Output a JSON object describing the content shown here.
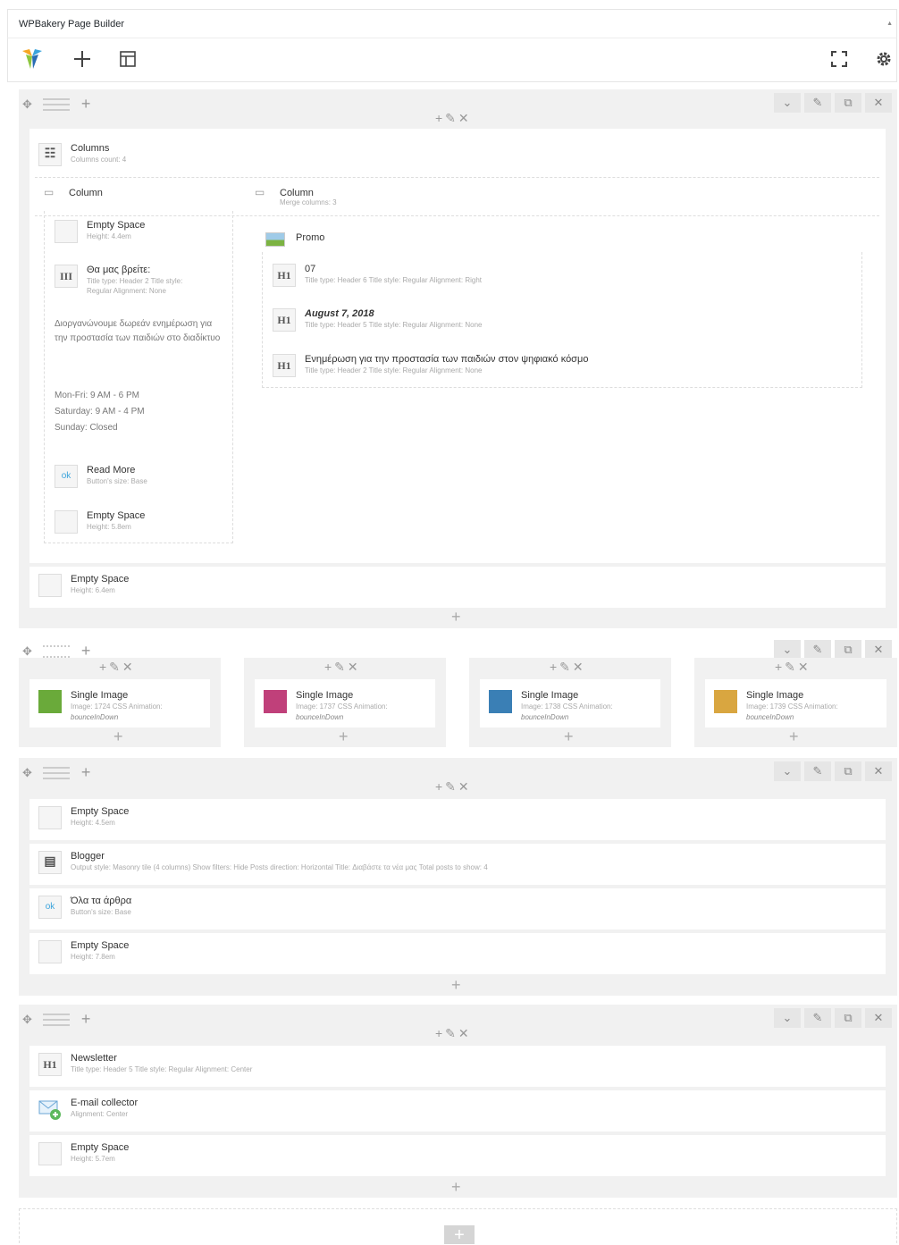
{
  "panel": {
    "title": "WPBakery Page Builder"
  },
  "row1": {
    "columns_el": {
      "title": "Columns",
      "meta": "Columns count: 4"
    },
    "col_left": {
      "title": "Column"
    },
    "col_right": {
      "title": "Column",
      "meta": "Merge columns: 3"
    },
    "left_items": [
      {
        "title": "Empty Space",
        "meta": "Height: 4.4em"
      },
      {
        "title": "Θα μας βρείτε:",
        "meta1": "Title type: Header 2  Title style:",
        "meta2": "Regular  Alignment: None"
      },
      {
        "title": "Read More",
        "meta": "Button's size: Base"
      },
      {
        "title": "Empty Space",
        "meta": "Height: 5.8em"
      }
    ],
    "left_text": "Διοργανώνουμε δωρεάν ενημέρωση για την προστασία των παιδιών στο διαδίκτυο",
    "hours": [
      "Mon-Fri: 9 AM - 6 PM",
      "Saturday: 9 AM - 4 PM",
      "Sunday: Closed"
    ],
    "promo": {
      "title": "Promo"
    },
    "right_items": [
      {
        "title": "07",
        "meta": "Title type: Header 6  Title style: Regular  Alignment: Right"
      },
      {
        "title": "August 7, 2018",
        "meta": "Title type: Header 5  Title style: Regular  Alignment: None"
      },
      {
        "title": "Ενημέρωση για την προστασία των παιδιών στον ψηφιακό κόσμο",
        "meta": "Title type: Header 2  Title style: Regular  Alignment: None"
      }
    ],
    "bottom_el": {
      "title": "Empty Space",
      "meta": "Height: 6.4em"
    }
  },
  "row2": {
    "images": [
      {
        "title": "Single Image",
        "meta1": "Image: 1724  CSS Animation:",
        "meta2": "bounceInDown",
        "color": "#6aaa3a"
      },
      {
        "title": "Single Image",
        "meta1": "Image: 1737  CSS Animation:",
        "meta2": "bounceInDown",
        "color": "#c0407a"
      },
      {
        "title": "Single Image",
        "meta1": "Image: 1738  CSS Animation:",
        "meta2": "bounceInDown",
        "color": "#3a7fb5"
      },
      {
        "title": "Single Image",
        "meta1": "Image: 1739  CSS Animation:",
        "meta2": "bounceInDown",
        "color": "#d9a640"
      }
    ]
  },
  "row3": {
    "items": [
      {
        "title": "Empty Space",
        "meta": "Height: 4.5em"
      },
      {
        "title": "Blogger",
        "meta": "Output style: Masonry tile (4 columns)  Show filters: Hide  Posts direction: Horizontal  Title: Διαβάστε τα νέα μας  Total posts to show: 4"
      },
      {
        "title": "Όλα τα άρθρα",
        "meta": "Button's size: Base"
      },
      {
        "title": "Empty Space",
        "meta": "Height: 7.8em"
      }
    ]
  },
  "row4": {
    "items": [
      {
        "title": "Newsletter",
        "meta": "Title type: Header 5  Title style: Regular  Alignment: Center"
      },
      {
        "title": "E-mail collector",
        "meta": "Alignment: Center"
      },
      {
        "title": "Empty Space",
        "meta": "Height: 5.7em"
      }
    ]
  },
  "icons": {
    "logo": "wpbakery-logo-icon",
    "add": "plus-icon",
    "templates": "layout-icon",
    "fullscreen": "fullscreen-icon",
    "settings": "gear-icon"
  },
  "colors": {
    "row_bg": "#f1f1f1",
    "accent": "#f6a623"
  }
}
